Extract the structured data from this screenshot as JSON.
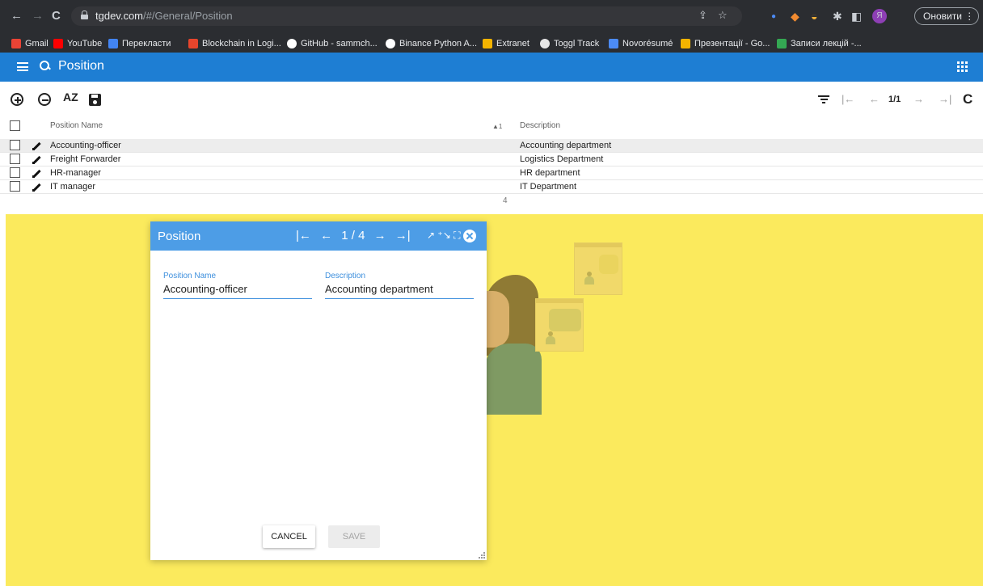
{
  "browser": {
    "url_host": "tgdev.com",
    "url_path": "/#/General/Position",
    "update_label": "Оновити",
    "nav_back": "←",
    "nav_forward": "→",
    "nav_reload": "C",
    "profile_letter": "Я",
    "bookmarks": [
      {
        "label": "Gmail",
        "color": "#ea4335"
      },
      {
        "label": "YouTube",
        "color": "#ff0000"
      },
      {
        "label": "Перекласти",
        "color": "#4285f4"
      },
      {
        "label": "Blockchain in Logi...",
        "color": "#e8452c"
      },
      {
        "label": "GitHub - sammch...",
        "color": "#ffffff"
      },
      {
        "label": "Binance Python A...",
        "color": "#ffffff"
      },
      {
        "label": "Extranet",
        "color": "#f4b400"
      },
      {
        "label": "Toggl Track",
        "color": "#e6e6e6"
      },
      {
        "label": "Novorésumé",
        "color": "#4c8bf5"
      },
      {
        "label": "Презентації - Go...",
        "color": "#f4b400"
      },
      {
        "label": "Записи лекцій -...",
        "color": "#34a853"
      }
    ]
  },
  "appbar": {
    "title": "Position",
    "accent": "#1e7ed3"
  },
  "toolbar": {
    "sort_label": "AZ",
    "pager_first": "|←",
    "pager_prev": "←",
    "pager_count": "1/1",
    "pager_next": "→",
    "pager_last": "→|",
    "refresh": "C"
  },
  "grid": {
    "columns": [
      {
        "label": "Position Name",
        "sort": "▲1"
      },
      {
        "label": "Description"
      }
    ],
    "rows": [
      {
        "name": "Accounting-officer",
        "description": "Accounting department",
        "selected": true
      },
      {
        "name": "Freight Forwarder",
        "description": "Logistics Department",
        "selected": false
      },
      {
        "name": "HR-manager",
        "description": "HR department",
        "selected": false
      },
      {
        "name": "IT manager",
        "description": "IT Department",
        "selected": false
      }
    ],
    "total": "4"
  },
  "dialog": {
    "title": "Position",
    "nav_first": "|←",
    "nav_prev": "←",
    "record": "1 / 4",
    "nav_next": "→",
    "nav_last": "→|",
    "tools": "↗ ⁺↘ ⛶",
    "fields": [
      {
        "label": "Position Name",
        "value": "Accounting-officer"
      },
      {
        "label": "Description",
        "value": "Accounting department"
      }
    ],
    "cancel_label": "CANCEL",
    "save_label": "SAVE",
    "header_color": "#4d9de6"
  },
  "background": {
    "color": "#fbea5d"
  }
}
